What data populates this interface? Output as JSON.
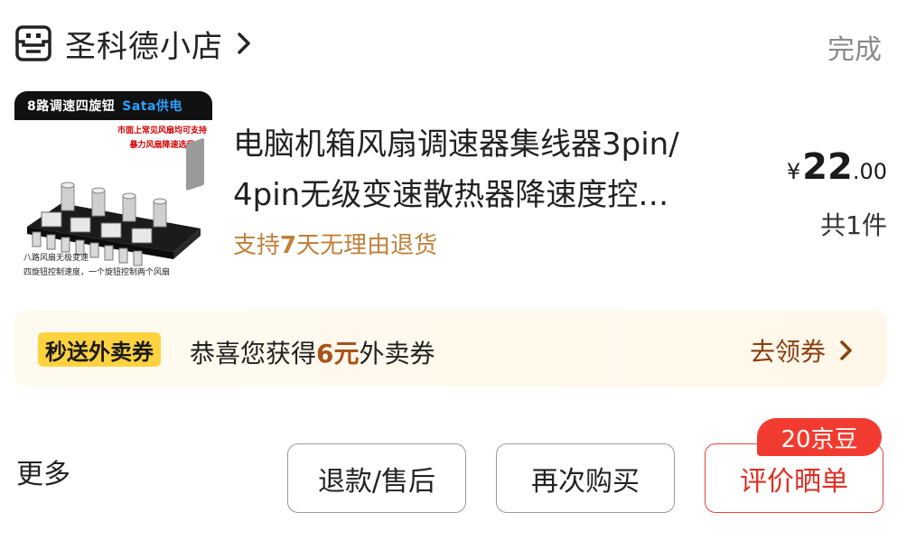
{
  "shop": {
    "icon": "shop-face-icon",
    "name": "圣科德小店",
    "chevron_icon": "chevron-right-icon"
  },
  "header": {
    "done_label": "完成"
  },
  "product": {
    "image": {
      "banner_left": "8路调速四旋钮",
      "banner_right": "Sata供电",
      "note_line1": "市面上常见风扇均可支持",
      "note_line2": "暴力风扇降速选我",
      "bottom_line1": "八路风扇无极变速",
      "bottom_line2": "四旋钮控制速度，一个旋钮控制两个风扇"
    },
    "title_line1": "电脑机箱风扇调速器集线器3pin/",
    "title_line2": "4pin无级变速散热器降速度控…",
    "return_prefix": "支持",
    "return_days": "7",
    "return_suffix": "天无理由退货",
    "price_currency": "¥",
    "price_integer": "22",
    "price_decimal": ".00",
    "quantity": "共1件"
  },
  "coupon": {
    "tag": "秒送外卖券",
    "text_prefix": "恭喜您获得",
    "amount": "6元",
    "text_suffix": "外卖券",
    "action_label": "去领券",
    "colors": {
      "background": "#fffaef",
      "tag": "#ffd23f",
      "action": "#8a3f0f"
    }
  },
  "footer": {
    "more_label": "更多",
    "refund_label": "退款/售后",
    "rebuy_label": "再次购买",
    "review_label": "评价晒单",
    "review_badge": "20京豆",
    "accent_color": "#e02e24"
  }
}
